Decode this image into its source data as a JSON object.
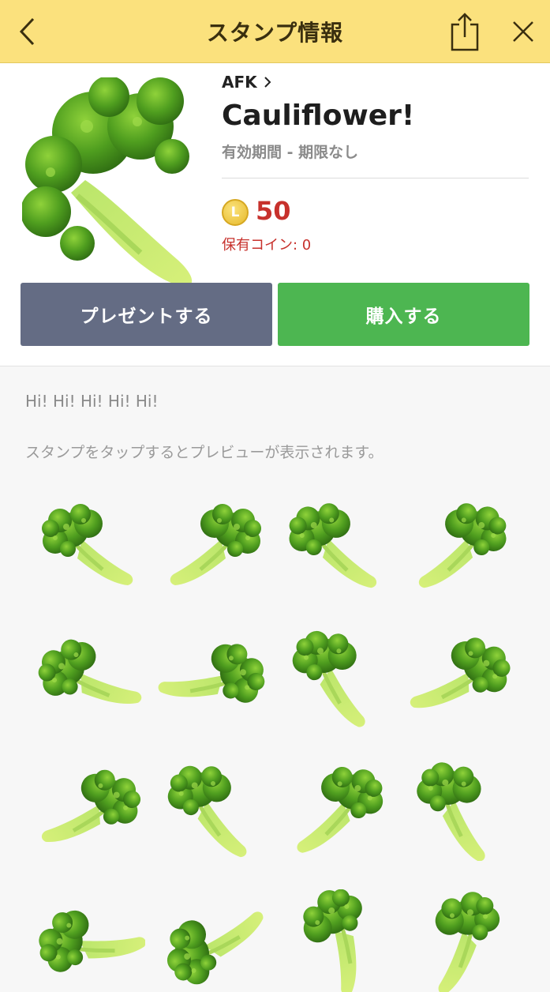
{
  "nav": {
    "title": "スタンプ情報",
    "back_icon": "chevron-left-icon",
    "share_icon": "share-icon",
    "close_icon": "close-icon"
  },
  "product": {
    "author": "AFK",
    "title": "Cauliflower!",
    "validity": "有効期間 - 期限なし",
    "coin_symbol": "L",
    "price": "50",
    "owned_coins": "保有コイン: 0"
  },
  "buttons": {
    "gift_label": "プレゼントする",
    "buy_label": "購入する"
  },
  "description": "Hi! Hi! Hi! Hi! Hi!",
  "preview_hint": "スタンプをタップするとプレビューが表示されます。",
  "colors": {
    "header_bg": "#fbe17d",
    "price_red": "#c7312c",
    "gift_button": "#646c84",
    "buy_button": "#4db651"
  },
  "sticker_count": 16
}
